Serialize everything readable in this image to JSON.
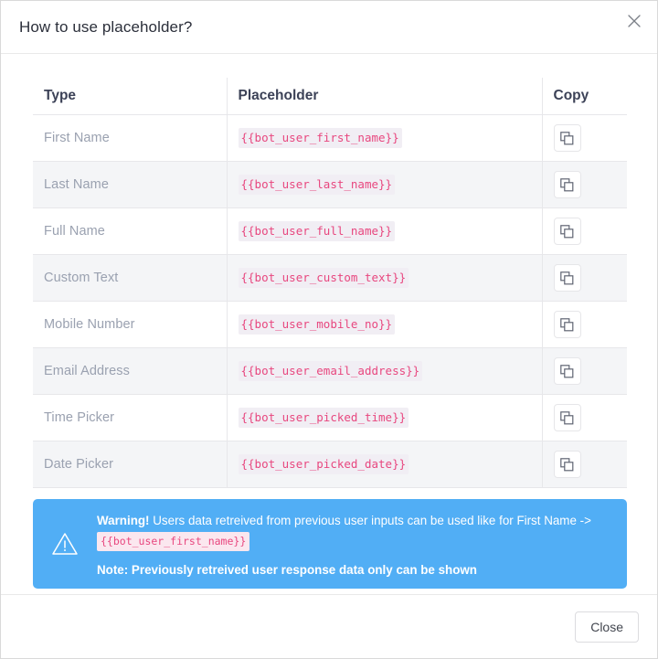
{
  "dialog": {
    "title": "How to use placeholder?",
    "close_icon": "close-icon"
  },
  "table": {
    "headers": {
      "type": "Type",
      "placeholder": "Placeholder",
      "copy": "Copy"
    },
    "rows": [
      {
        "type": "First Name",
        "placeholder": "{{bot_user_first_name}}",
        "copy_icon": "copy-icon"
      },
      {
        "type": "Last Name",
        "placeholder": "{{bot_user_last_name}}",
        "copy_icon": "copy-icon"
      },
      {
        "type": "Full Name",
        "placeholder": "{{bot_user_full_name}}",
        "copy_icon": "copy-icon"
      },
      {
        "type": "Custom Text",
        "placeholder": "{{bot_user_custom_text}}",
        "copy_icon": "copy-icon"
      },
      {
        "type": "Mobile Number",
        "placeholder": "{{bot_user_mobile_no}}",
        "copy_icon": "copy-icon"
      },
      {
        "type": "Email Address",
        "placeholder": "{{bot_user_email_address}}",
        "copy_icon": "copy-icon"
      },
      {
        "type": "Time Picker",
        "placeholder": "{{bot_user_picked_time}}",
        "copy_icon": "copy-icon"
      },
      {
        "type": "Date Picker",
        "placeholder": "{{bot_user_picked_date}}",
        "copy_icon": "copy-icon"
      }
    ]
  },
  "warning": {
    "icon": "warning-triangle-icon",
    "bold_lead": "Warning!",
    "body": " Users data retreived from previous user inputs can be used like for First Name -> ",
    "inline_code": "{{bot_user_first_name}}",
    "note": "Note: Previously retreived user response data only can be shown"
  },
  "footer": {
    "close_label": "Close"
  },
  "colors": {
    "banner_blue": "#51aef5",
    "code_pink": "#e8477f",
    "code_bg": "#f1eef4",
    "row_alt": "#f4f5f7",
    "border": "#e7e7ea",
    "title_text": "#2b2f3a",
    "type_text": "#9aa1b0"
  }
}
